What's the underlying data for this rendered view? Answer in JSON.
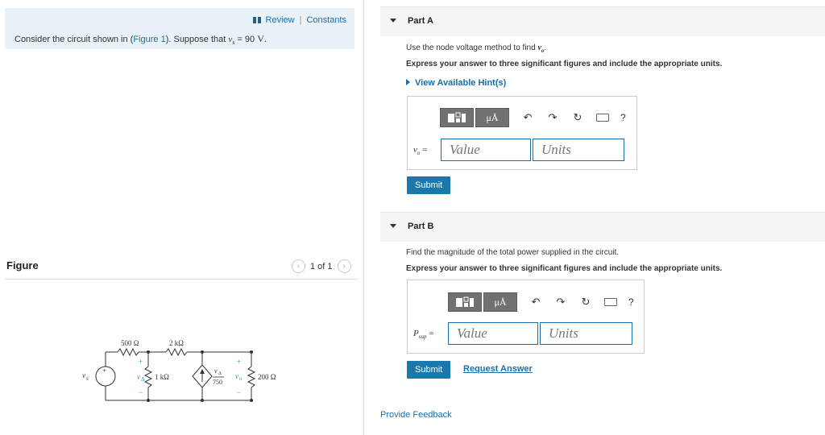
{
  "header": {
    "review": "Review",
    "separator": "|",
    "constants": "Constants"
  },
  "problem": {
    "prefix": "Consider the circuit shown in (",
    "figure_link": "Figure 1",
    "suffix": "). Suppose that ",
    "var": "v",
    "var_sub": "s",
    "equals": " = 90",
    "unit": "V",
    "period": "."
  },
  "figure": {
    "label": "Figure",
    "pager": "1 of 1",
    "prev": "‹",
    "next": "›"
  },
  "circuit": {
    "r1": "500 Ω",
    "r2": "2 kΩ",
    "r3": "1 kΩ",
    "r4": "200 Ω",
    "source_label": "v",
    "source_sub": "s",
    "vdelta": "v",
    "vdelta_sub": "Δ",
    "dep_num": "v",
    "dep_num_sub": "Δ",
    "dep_den": "750",
    "vo": "v",
    "vo_sub": "o",
    "plus": "+",
    "minus": "−"
  },
  "part_a": {
    "title": "Part A",
    "instruction_prefix": "Use the node voltage method to find ",
    "instruction_var": "v",
    "instruction_sub": "o",
    "instruction_end": ".",
    "express": "Express your answer to three significant figures and include the appropriate units.",
    "hint": "View Available Hint(s)",
    "var_label": "v",
    "var_sub": "o",
    "eq": " =",
    "value_placeholder": "Value",
    "units_placeholder": "Units",
    "submit": "Submit"
  },
  "part_b": {
    "title": "Part B",
    "instruction": "Find the magnitude of the total power supplied in the circuit.",
    "express": "Express your answer to three significant figures and include the appropriate units.",
    "var_label": "P",
    "var_sub": "sup",
    "eq": " =",
    "value_placeholder": "Value",
    "units_placeholder": "Units",
    "submit": "Submit",
    "request_answer": "Request Answer"
  },
  "toolbar": {
    "mu_label": "μÅ",
    "help": "?"
  },
  "footer": {
    "feedback": "Provide Feedback"
  },
  "colors": {
    "link": "#1a6fa8",
    "submit": "#1a78ad",
    "problem_bg": "#e8f2f8"
  }
}
